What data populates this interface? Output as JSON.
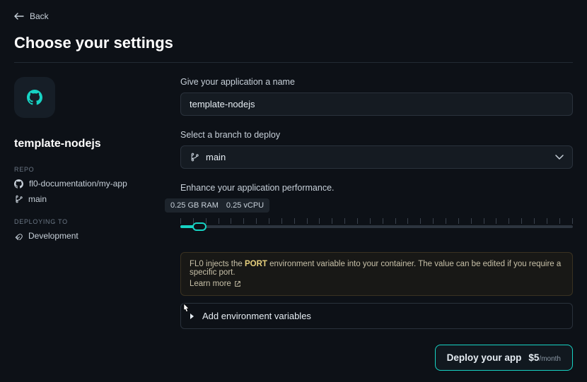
{
  "nav": {
    "back_label": "Back"
  },
  "page_title": "Choose your settings",
  "sidebar": {
    "project_name": "template-nodejs",
    "repo_label": "REPO",
    "repo_path": "fl0-documentation/my-app",
    "branch": "main",
    "deploying_to_label": "DEPLOYING TO",
    "environment": "Development"
  },
  "form": {
    "app_name_label": "Give your application a name",
    "app_name_value": "template-nodejs",
    "branch_label": "Select a branch to deploy",
    "branch_value": "main",
    "performance_label": "Enhance your application performance.",
    "slider_tooltip_ram": "0.25 GB RAM",
    "slider_tooltip_cpu": "0.25 vCPU",
    "note_prefix": "FL0 injects the ",
    "note_port": "PORT",
    "note_suffix": " environment variable into your container. The value can be edited if you require a specific port.",
    "learn_more": "Learn more",
    "env_expander_label": "Add environment variables"
  },
  "footer": {
    "deploy_label": "Deploy your app",
    "price": "$5",
    "period": "/month"
  },
  "colors": {
    "teal": "#17d3c4",
    "bg": "#0d1117"
  }
}
